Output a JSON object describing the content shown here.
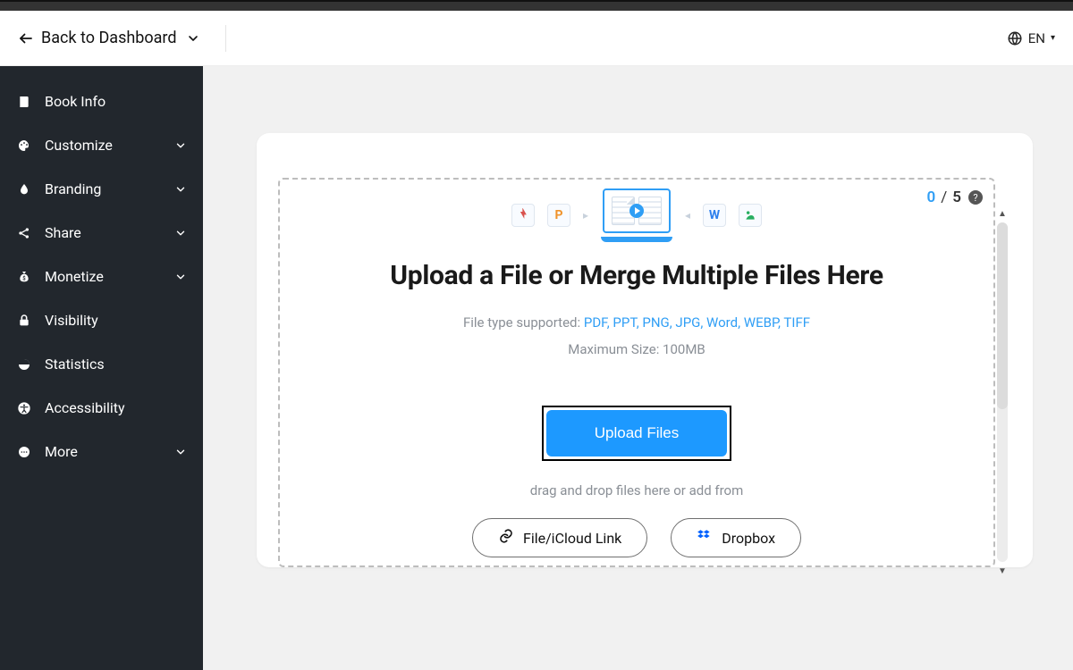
{
  "header": {
    "back_label": "Back to Dashboard",
    "language_label": "EN"
  },
  "sidebar": {
    "items": [
      {
        "key": "book-info",
        "label": "Book Info",
        "icon": "book",
        "expandable": false
      },
      {
        "key": "customize",
        "label": "Customize",
        "icon": "palette",
        "expandable": true
      },
      {
        "key": "branding",
        "label": "Branding",
        "icon": "drop",
        "expandable": true
      },
      {
        "key": "share",
        "label": "Share",
        "icon": "share",
        "expandable": true
      },
      {
        "key": "monetize",
        "label": "Monetize",
        "icon": "money-bag",
        "expandable": true
      },
      {
        "key": "visibility",
        "label": "Visibility",
        "icon": "lock",
        "expandable": false
      },
      {
        "key": "statistics",
        "label": "Statistics",
        "icon": "pie",
        "expandable": false
      },
      {
        "key": "accessibility",
        "label": "Accessibility",
        "icon": "universal",
        "expandable": false
      },
      {
        "key": "more",
        "label": "More",
        "icon": "more",
        "expandable": true
      }
    ]
  },
  "upload": {
    "title": "Upload a File or Merge Multiple Files Here",
    "file_types_label": "File type supported: ",
    "file_types": "PDF, PPT, PNG, JPG, Word, WEBP, TIFF",
    "max_size_label": "Maximum Size: 100MB",
    "upload_button_label": "Upload Files",
    "drag_drop_label": "drag and drop files here or add from",
    "source_file_link_label": "File/iCloud Link",
    "source_dropbox_label": "Dropbox"
  },
  "counter": {
    "current": "0",
    "separator": "/",
    "max": "5"
  }
}
